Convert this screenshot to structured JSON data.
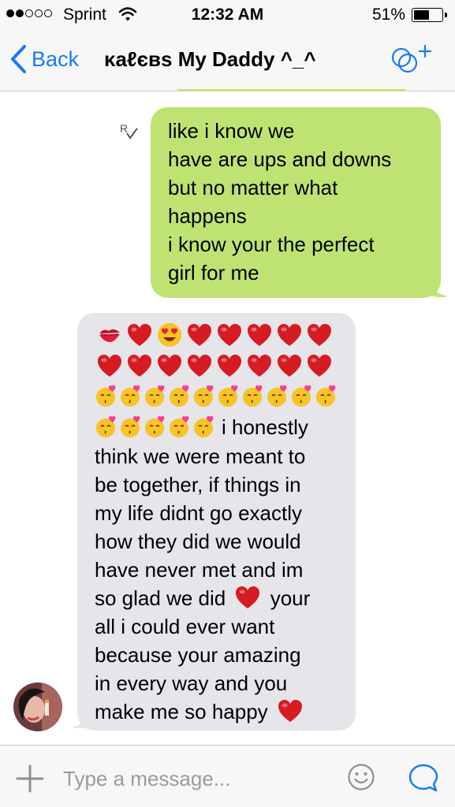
{
  "status_bar": {
    "carrier": "Sprint",
    "signal_bars": 2,
    "signal_total": 5,
    "time": "12:32 AM",
    "battery_percent_text": "51%",
    "battery_level": 0.51
  },
  "nav": {
    "back_label": "Back",
    "title": "κaℓєвs My Daddy ^_^",
    "accent_color": "#1a7bf2"
  },
  "messages": {
    "outgoing": {
      "lines": [
        "like i know we",
        "have are ups and downs",
        "but no matter what",
        "happens",
        "i know your the perfect",
        "girl for me"
      ],
      "bubble_color": "#bfe373",
      "receipt_icon": "read-receipt-icon"
    },
    "incoming": {
      "emoji_row_1": [
        "kiss-mark",
        "heart",
        "heart-eyes",
        "heart",
        "heart",
        "heart",
        "heart",
        "heart"
      ],
      "emoji_row_2": [
        "heart",
        "heart",
        "heart",
        "heart",
        "heart",
        "heart",
        "heart",
        "heart"
      ],
      "emoji_row_3_count": 10,
      "emoji_row_4_count": 5,
      "line_4_text": "i honestly",
      "lines": [
        "think we were meant to",
        "be together, if things in",
        "my life didnt go exactly",
        "how they did we would",
        "have never met and im"
      ],
      "line_heart_before": "so glad we did",
      "line_heart_after": "your",
      "lines_after": [
        "all i could ever want",
        "because your amazing",
        "in every way and you"
      ],
      "last_line": "make me so happy",
      "bubble_color": "#e5e5ea"
    }
  },
  "input_bar": {
    "placeholder": "Type a message...",
    "icons": [
      "plus-icon",
      "emoji-icon",
      "send-icon"
    ]
  }
}
